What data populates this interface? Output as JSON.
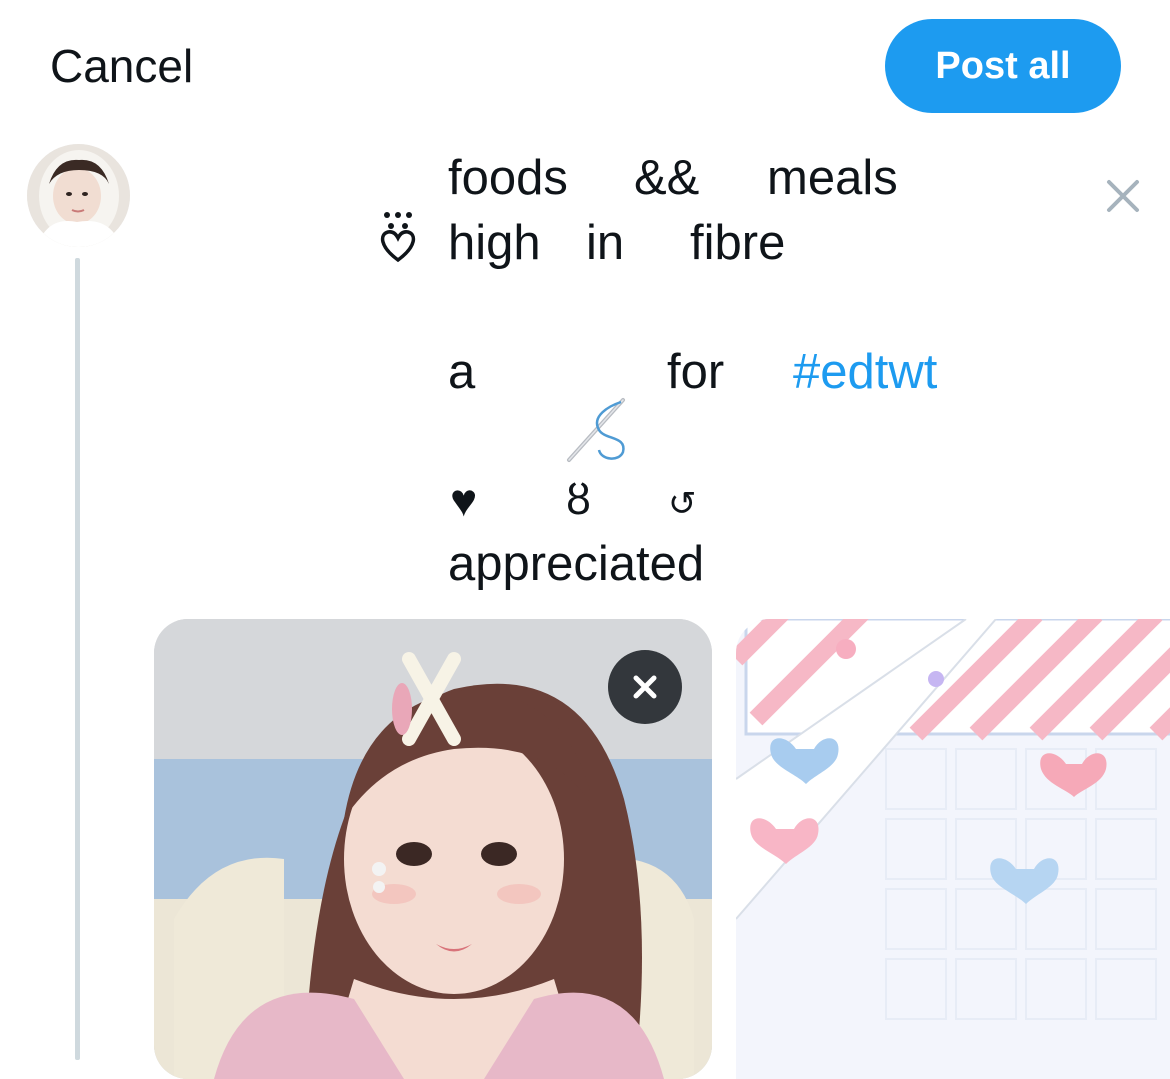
{
  "header": {
    "cancel_label": "Cancel",
    "post_all_label": "Post all"
  },
  "composer": {
    "lines": [
      {
        "parts": [
          "foods",
          "&&",
          "meals"
        ]
      },
      {
        "parts": [
          "high",
          "in",
          "fibre"
        ]
      },
      {
        "parts": [
          "a",
          "for"
        ],
        "hashtag": "#edtwt"
      },
      {
        "parts": [
          "appreciated"
        ]
      }
    ],
    "decor": {
      "heart_dots_icon": "heart-with-dots",
      "needle_icon": "sewing-needle",
      "black_heart_glyph": "♥",
      "ribbon_glyph": "ȣ",
      "loop_glyph": "↺"
    },
    "remove_icon": "close-icon"
  },
  "media": {
    "image1": "photo of girl with pink bow hair clips and pink cardigan",
    "image2": "pastel pink and blue pattern with hearts and stripes",
    "remove_icon": "close-icon"
  },
  "colors": {
    "accent": "#1d9bf0",
    "text": "#0f1419",
    "thread_line": "#cfd9de",
    "close_gray": "#a6b3bd"
  }
}
